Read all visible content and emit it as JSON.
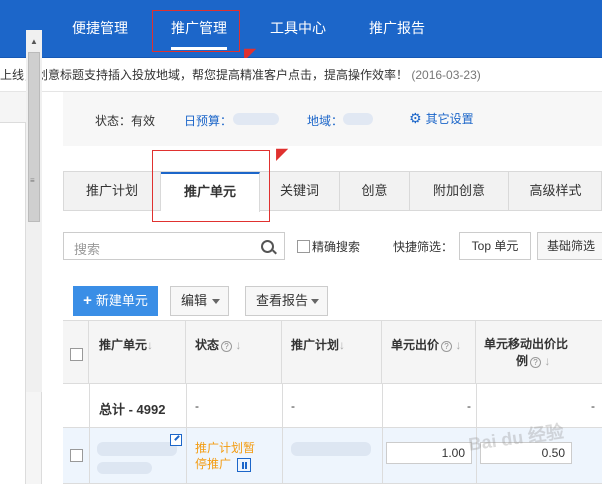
{
  "topnav": {
    "items": [
      {
        "label": "便捷管理"
      },
      {
        "label": "推广管理",
        "active": true
      },
      {
        "label": "工具中心"
      },
      {
        "label": "推广报告"
      }
    ]
  },
  "notice": {
    "text": "上线，创意标题支持插入投放地域，帮您提高精准客户点击，提高操作效率！",
    "date": "(2016-03-23)"
  },
  "status_bar": {
    "status": "状态：有效",
    "budget_label": "日预算：",
    "region_label": "地域：",
    "settings_label": "其它设置",
    "settings_icon": "gear-icon"
  },
  "tabs": [
    {
      "label": "推广计划"
    },
    {
      "label": "推广单元",
      "active": true
    },
    {
      "label": "关键词"
    },
    {
      "label": "创意"
    },
    {
      "label": "附加创意"
    },
    {
      "label": "高级样式"
    }
  ],
  "filter": {
    "search_placeholder": "搜索",
    "exact_search_label": "精确搜索",
    "quick_filter_label": "快捷筛选：",
    "top_unit_button": "Top 单元",
    "basic_filter_button": "基础筛选"
  },
  "toolbar": {
    "new_unit": "新建单元",
    "edit": "编辑",
    "view_report": "查看报告"
  },
  "table": {
    "headers": {
      "unit": "推广单元",
      "status": "状态",
      "plan": "推广计划",
      "bid": "单元出价",
      "mobile_bid_line1": "单元移动出价比",
      "mobile_bid_line2": "例"
    },
    "total_row": {
      "label": "总计 - 4992",
      "status": "-",
      "plan": "-",
      "bid": "-",
      "mobile": "-"
    },
    "rows": [
      {
        "status": "推广计划暂停推广",
        "bid": "1.00",
        "mobile_ratio": "0.50"
      }
    ]
  },
  "watermark": "Bai du 经验",
  "colors": {
    "nav_bg": "#1c66c9",
    "accent": "#1c66c9",
    "primary_button": "#3a8ee6",
    "annotation_red": "#e0312f",
    "status_orange": "#f39c12"
  }
}
